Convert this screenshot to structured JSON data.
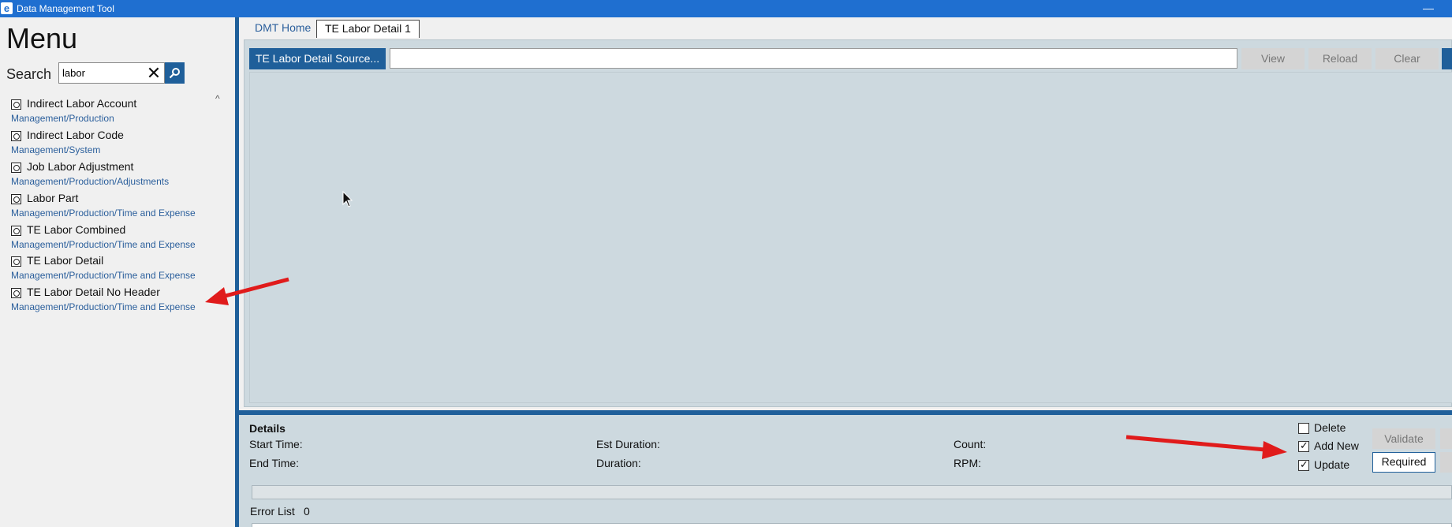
{
  "titlebar": {
    "app_icon": "e",
    "title": "Data Management Tool",
    "minimize": "—"
  },
  "sidebar": {
    "menu_title": "Menu",
    "search_label": "Search",
    "search_value": "labor",
    "items": [
      {
        "name": "Indirect Labor Account",
        "path": "Management/Production"
      },
      {
        "name": "Indirect Labor Code",
        "path": "Management/System"
      },
      {
        "name": "Job Labor Adjustment",
        "path": "Management/Production/Adjustments"
      },
      {
        "name": "Labor Part",
        "path": "Management/Production/Time and Expense"
      },
      {
        "name": "TE Labor Combined",
        "path": "Management/Production/Time and Expense"
      },
      {
        "name": "TE Labor Detail",
        "path": "Management/Production/Time and Expense"
      },
      {
        "name": "TE Labor Detail No Header",
        "path": "Management/Production/Time and Expense"
      }
    ]
  },
  "tabs": {
    "home": "DMT Home",
    "active": "TE Labor Detail 1"
  },
  "toolbar": {
    "source_button": "TE Labor Detail Source...",
    "source_value": "",
    "view": "View",
    "reload": "Reload",
    "clear": "Clear"
  },
  "details": {
    "header": "Details",
    "start_time": "Start Time:",
    "end_time": "End Time:",
    "est_duration": "Est Duration:",
    "duration": "Duration:",
    "count": "Count:",
    "rpm": "RPM:",
    "delete": "Delete",
    "add_new": "Add New",
    "update": "Update",
    "delete_checked": false,
    "add_new_checked": true,
    "update_checked": true,
    "validate": "Validate",
    "required": "Required",
    "error_list": "Error List",
    "error_count": "0"
  },
  "colors": {
    "titlebar": "#1f6fd0",
    "accent": "#1f5f9a",
    "panel": "#cdd9df",
    "arrow": "#e01b1b"
  }
}
